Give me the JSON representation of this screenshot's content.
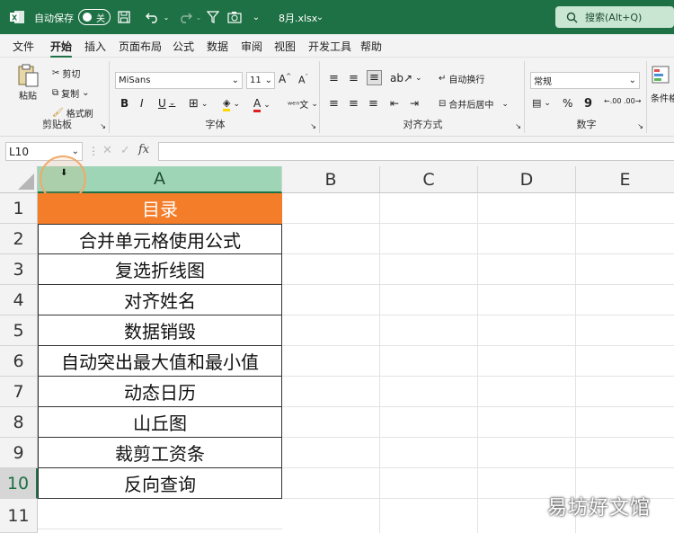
{
  "titlebar": {
    "autosave_label": "自动保存",
    "autosave_state": "关",
    "filename": "8月.xlsx",
    "search_label": "搜索(Alt+Q)"
  },
  "menu": [
    "文件",
    "开始",
    "插入",
    "页面布局",
    "公式",
    "数据",
    "审阅",
    "视图",
    "开发工具",
    "帮助"
  ],
  "ribbon": {
    "clipboard": {
      "paste": "粘贴",
      "cut": "剪切",
      "copy": "复制",
      "format_painter": "格式刷",
      "label": "剪贴板"
    },
    "font": {
      "name": "MiSans",
      "size": "11",
      "bold": "B",
      "italic": "I",
      "underline": "U",
      "font_color_letter": "A",
      "label": "字体"
    },
    "alignment": {
      "wrap": "自动换行",
      "merge": "合并后居中",
      "label": "对齐方式"
    },
    "number": {
      "format": "常规",
      "label": "数字"
    },
    "styles": {
      "conditional": "条件格"
    }
  },
  "formulabar": {
    "name_box": "L10",
    "fx": "fx",
    "formula": ""
  },
  "grid": {
    "columns": [
      "A",
      "B",
      "C",
      "D",
      "E"
    ],
    "selected_column": "A",
    "rows": [
      "1",
      "2",
      "3",
      "4",
      "5",
      "6",
      "7",
      "8",
      "9",
      "10",
      "11"
    ],
    "selected_row": "10",
    "cells": [
      "目录",
      "合并单元格使用公式",
      "复选折线图",
      "对齐姓名",
      "数据销毁",
      "自动突出最大值和最小值",
      "动态日历",
      "山丘图",
      "裁剪工资条",
      "反向查询"
    ],
    "header_fill": "#f47d2a"
  },
  "watermark": "易坊好文馆"
}
